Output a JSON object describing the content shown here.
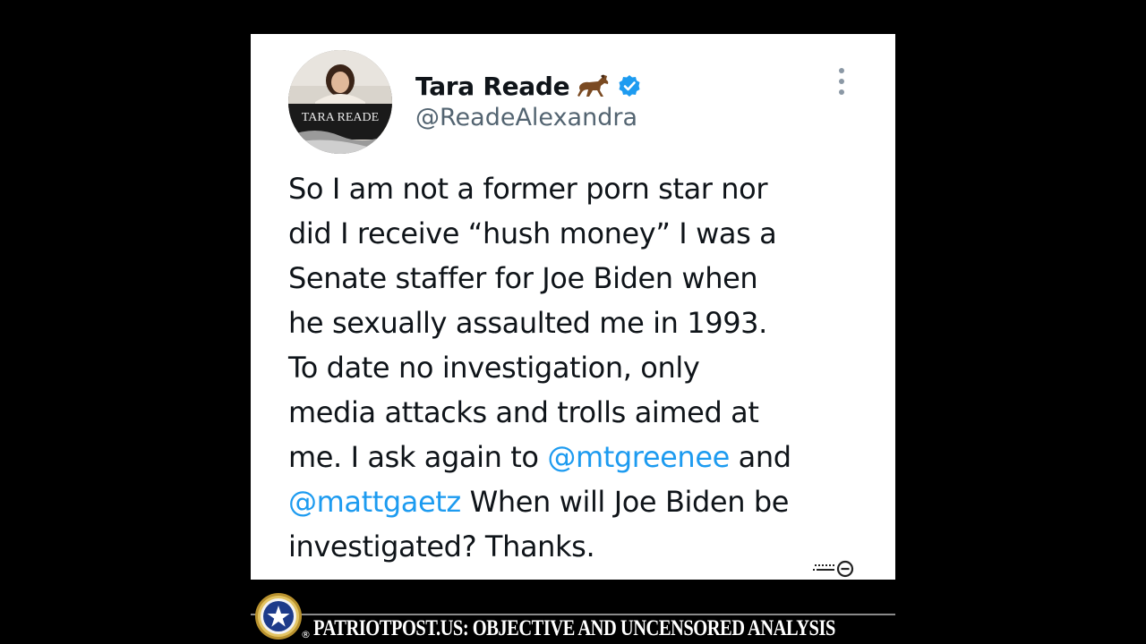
{
  "tweet": {
    "display_name": "Tara Reade",
    "handle": "@ReadeAlexandra",
    "emoji_icon": "horse-icon",
    "verified_icon": "verified-badge-icon",
    "avatar_caption": "TARA READE",
    "lines": {
      "l1": "So I am not a former porn star nor",
      "l2": "did I receive “hush money” I was a",
      "l3": "Senate staffer for Joe Biden when",
      "l4": "he sexually assaulted me in 1993.",
      "l5": "To date no investigation, only",
      "l6": "media attacks and trolls aimed at",
      "l7_pre": "me. I ask again to ",
      "l7_mention": "@mtgreenee",
      "l7_post": " and",
      "l8_mention": "@mattgaetz",
      "l8_post": " When will Joe Biden be",
      "l9": "investigated? Thanks."
    }
  },
  "banner": {
    "text": "PATRIOTPOST.US: OBJECTIVE AND UNCENSORED ANALYSIS",
    "registered_mark": "®"
  },
  "colors": {
    "mention": "#1d9bf0",
    "handle": "#536471",
    "text": "#0f1419",
    "verified": "#1d9bf0",
    "background": "#000000"
  }
}
